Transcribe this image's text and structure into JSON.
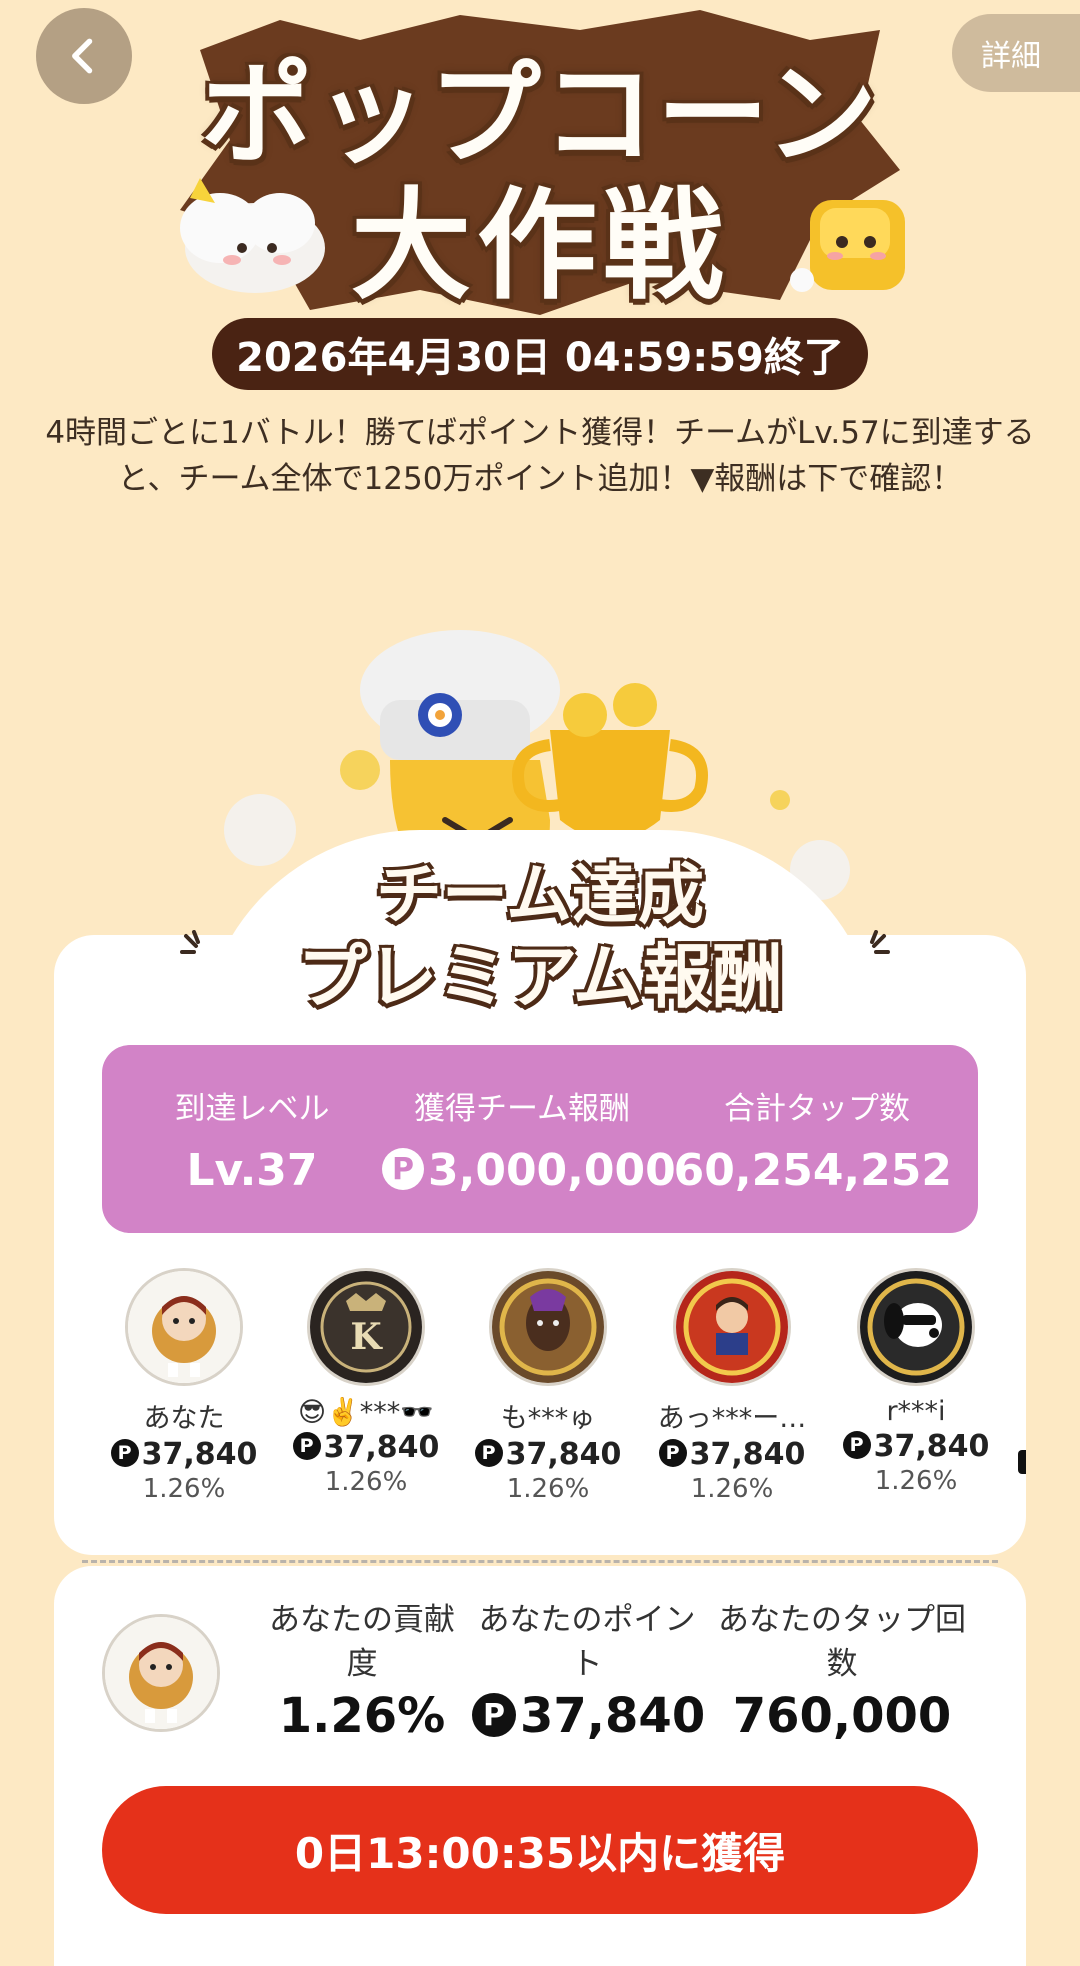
{
  "header": {
    "title_line1": "ポップコーン",
    "title_line2": "大作戦",
    "detail_label": "詳細",
    "end_date": "2026年4月30日 04:59:59終了"
  },
  "description": "4時間ごとに1バトル！勝てばポイント獲得！チームがLv.57に到達すると、チーム全体で1250万ポイント追加！▼報酬は下で確認！",
  "reward": {
    "title_line1": "チーム達成",
    "title_line2": "プレミアム報酬"
  },
  "stats": {
    "level_label": "到達レベル",
    "level_value": "Lv.37",
    "reward_label": "獲得チーム報酬",
    "reward_value": "3,000,000",
    "taps_label": "合計タップ数",
    "taps_value": "60,254,252"
  },
  "currency_symbol": "P",
  "members": [
    {
      "name": "あなた",
      "points": "37,840",
      "percent": "1.26%"
    },
    {
      "name": "😎✌️***🕶️",
      "points": "37,840",
      "percent": "1.26%"
    },
    {
      "name": "も***ゅ",
      "points": "37,840",
      "percent": "1.26%"
    },
    {
      "name": "あっ***ー…",
      "points": "37,840",
      "percent": "1.26%"
    },
    {
      "name": "r***i",
      "points": "37,840",
      "percent": "1.26%"
    }
  ],
  "my_contribution": {
    "contribution_label": "あなたの貢献度",
    "contribution_value": "1.26%",
    "points_label": "あなたのポイント",
    "points_value": "37,840",
    "taps_label": "あなたのタップ回数",
    "taps_value": "760,000"
  },
  "claim_button_label": "0日13:00:35以内に獲得",
  "colors": {
    "background": "#fde9c4",
    "stats_box": "#d283c7",
    "claim_button": "#e5311a",
    "date_pill": "#4a2313"
  }
}
